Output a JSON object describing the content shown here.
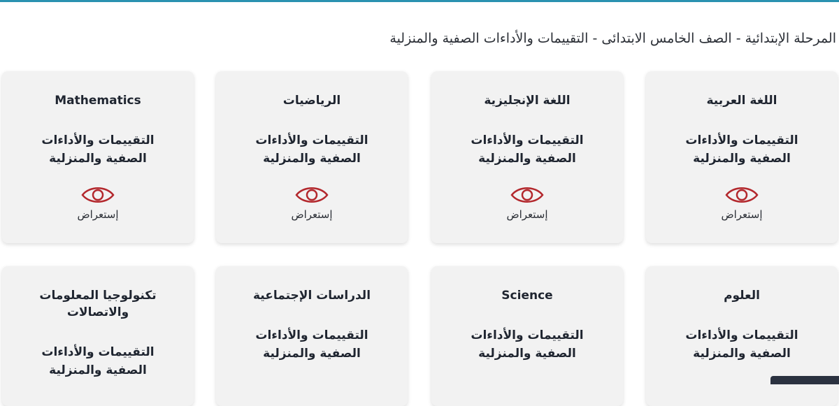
{
  "page": {
    "breadcrumb": "المرحلة الإبتدائية - الصف الخامس الابتدائى - التقييمات والأداءات الصفية والمنزلية"
  },
  "colors": {
    "accent_bar": "#2a92b0",
    "eye_icon": "#b3282d",
    "card_bg": "#f2f2f2"
  },
  "cards": [
    {
      "title": "اللغة العربية",
      "desc1": "التقييمات والأداءات",
      "desc2": "الصفية والمنزلية",
      "view_label": "إستعراض",
      "icon": "eye-icon"
    },
    {
      "title": "اللغة الإنجليزية",
      "desc1": "التقييمات والأداءات",
      "desc2": "الصفية والمنزلية",
      "view_label": "إستعراض",
      "icon": "eye-icon"
    },
    {
      "title": "الرياضيات",
      "desc1": "التقييمات والأداءات",
      "desc2": "الصفية والمنزلية",
      "view_label": "إستعراض",
      "icon": "eye-icon"
    },
    {
      "title": "Mathematics",
      "desc1": "التقييمات والأداءات",
      "desc2": "الصفية والمنزلية",
      "view_label": "إستعراض",
      "icon": "eye-icon"
    },
    {
      "title": "العلوم",
      "desc1": "التقييمات والأداءات",
      "desc2": "الصفية والمنزلية"
    },
    {
      "title": "Science",
      "desc1": "التقييمات والأداءات",
      "desc2": "الصفية والمنزلية"
    },
    {
      "title": "الدراسات الإجتماعية",
      "desc1": "التقييمات والأداءات",
      "desc2": "الصفية والمنزلية"
    },
    {
      "title": "تكنولوجيا المعلومات والاتصالات",
      "desc1": "التقييمات والأداءات",
      "desc2": "الصفية والمنزلية"
    }
  ]
}
